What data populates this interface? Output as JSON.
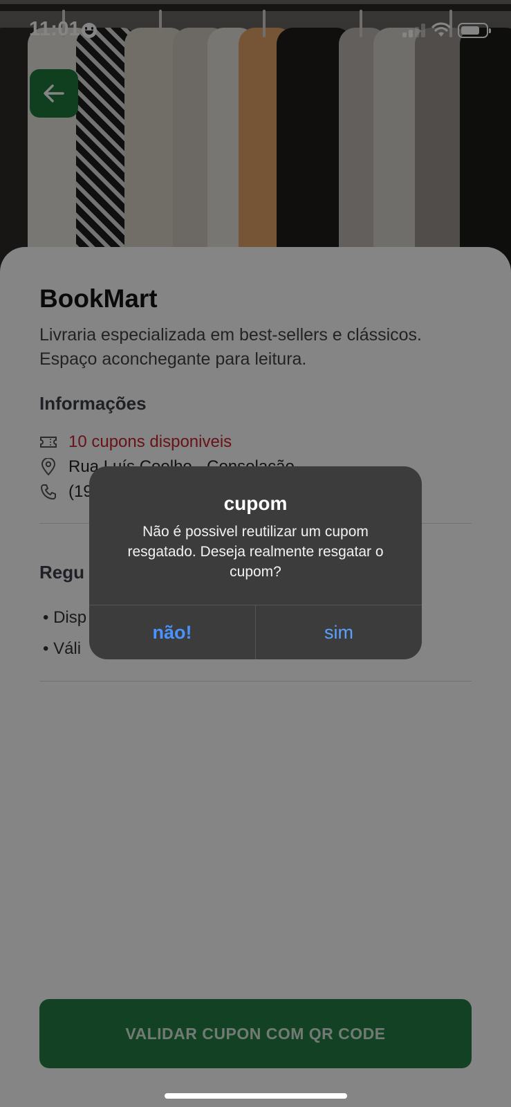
{
  "status_bar": {
    "time": "11:01"
  },
  "store": {
    "name": "BookMart",
    "description": "Livraria especializada em best-sellers e clássicos. Espaço aconchegante para leitura."
  },
  "info": {
    "title": "Informações",
    "coupons": "10 cupons disponiveis",
    "address": "Rua Luís Coelho - Consolação",
    "phone": "(19"
  },
  "rules": {
    "title": "Regu",
    "items": [
      "• Disp",
      "• Váli"
    ]
  },
  "cta_label": "VALIDAR CUPON COM QR CODE",
  "alert": {
    "title": "cupom",
    "message": "Não é possivel reutilizar um cupom resgatado. Deseja realmente resgatar o cupom?",
    "no_label": "não!",
    "yes_label": "sim"
  },
  "colors": {
    "brand_green": "#247f43",
    "coupon_red": "#c6262e",
    "alert_bg": "#3c3c3c",
    "alert_button": "#5aa1ff"
  },
  "icons": [
    "back-arrow-icon",
    "ticket-icon",
    "map-pin-icon",
    "phone-icon",
    "signal-icon",
    "wifi-icon",
    "battery-icon"
  ]
}
